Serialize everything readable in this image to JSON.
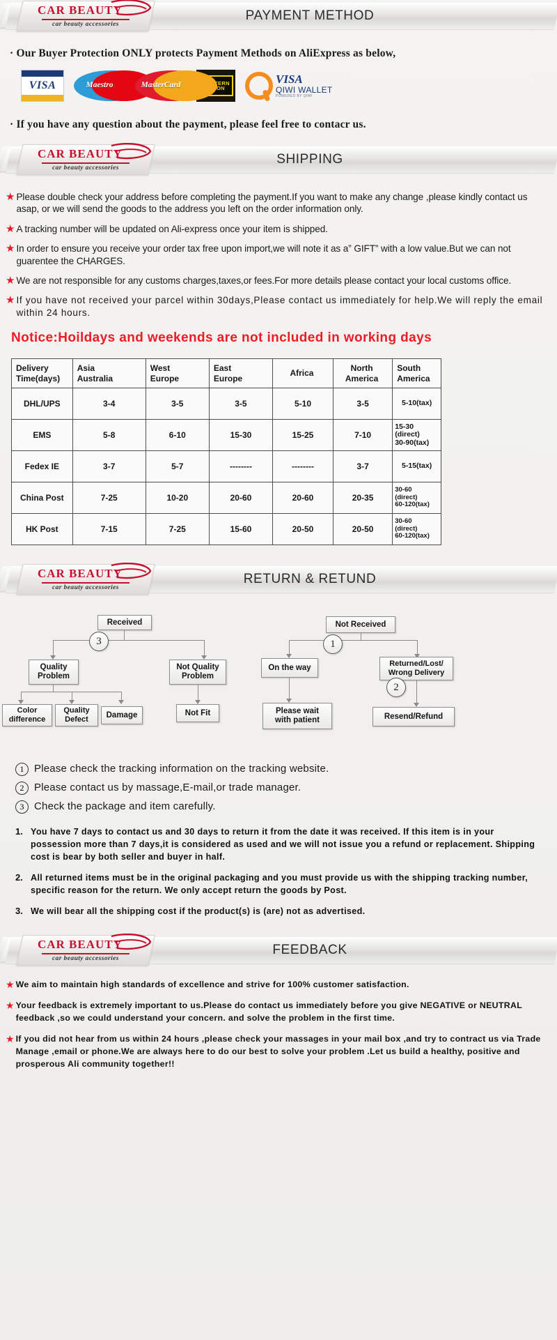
{
  "brand": {
    "name": "CAR  BEAUTY",
    "tagline": "car beauty accessories"
  },
  "sections": {
    "payment": {
      "title": "PAYMENT METHOD",
      "intro": "· Our Buyer Protection ONLY protects Payment Methods on AliExpress as below,",
      "outro": "· If you have any question about the payment, please feel free to contacr us.",
      "logos": [
        {
          "name": "visa-logo",
          "label": "VISA"
        },
        {
          "name": "maestro-logo",
          "label": "Maestro"
        },
        {
          "name": "mastercard-logo",
          "label": "MasterCard"
        },
        {
          "name": "western-union-logo",
          "label_top": "WESTERN",
          "label_bottom": "UNION"
        },
        {
          "name": "qiwi-wallet-logo",
          "visa": "VISA",
          "wallet": "QIWI WALLET",
          "powered": "POWERED BY QIWI"
        }
      ]
    },
    "shipping": {
      "title": "SHIPPING",
      "bullets": [
        "Please double check your address before completing the payment.If you want to make any change ,please kindly contact us asap, or we will send the goods to the address you left on the order information only.",
        "A tracking number will be updated on Ali-express once your item is shipped.",
        "In order to ensure you receive your order tax free upon import,we will note it as a” GIFT” with a low value.But we can not guarentee the CHARGES.",
        "We are not responsible for any customs charges,taxes,or fees.For more details please contact your local customs office.",
        "If you have not received your parcel within 30days,Please contact us immediately for help.We will reply the email within 24 hours."
      ],
      "notice": "Notice:Hoildays and weekends are not included in working days",
      "table": {
        "headers": [
          "Delivery\nTime(days)",
          "Asia\nAustralia",
          "West\nEurope",
          "East\nEurope",
          "Africa",
          "North\nAmerica",
          "South\nAmerica"
        ],
        "rows": [
          {
            "method": "DHL/UPS",
            "values": [
              "3-4",
              "3-5",
              "3-5",
              "5-10",
              "3-5",
              "5-10(tax)"
            ]
          },
          {
            "method": "EMS",
            "values": [
              "5-8",
              "6-10",
              "15-30",
              "15-25",
              "7-10",
              "15-30\n(direct)\n30-90(tax)"
            ]
          },
          {
            "method": "Fedex IE",
            "values": [
              "3-7",
              "5-7",
              "--------",
              "--------",
              "3-7",
              "5-15(tax)"
            ]
          },
          {
            "method": "China Post",
            "values": [
              "7-25",
              "10-20",
              "20-60",
              "20-60",
              "20-35",
              "30-60\n(direct)\n60-120(tax)"
            ]
          },
          {
            "method": "HK Post",
            "values": [
              "7-15",
              "7-25",
              "15-60",
              "20-50",
              "20-50",
              "30-60\n(direct)\n60-120(tax)"
            ]
          }
        ]
      }
    },
    "return": {
      "title": "RETURN & RETUND",
      "flow": {
        "received": "Received",
        "quality_problem": "Quality\nProblem",
        "not_quality_problem": "Not Quality\nProblem",
        "color_difference": "Color\ndifference",
        "quality_defect": "Quality\nDefect",
        "damage": "Damage",
        "not_fit": "Not Fit",
        "not_received": "Not  Received",
        "on_the_way": "On the way",
        "returned_lost": "Returned/Lost/\nWrong Delivery",
        "please_wait": "Please wait\nwith patient",
        "resend_refund": "Resend/Refund",
        "badge_1": "1",
        "badge_2": "2",
        "badge_3": "3"
      },
      "notes": [
        {
          "num": "1",
          "text": "Please check the tracking information on the tracking website."
        },
        {
          "num": "2",
          "text": "Please contact us by  massage,E-mail,or trade manager."
        },
        {
          "num": "3",
          "text": "Check the package and item carefully."
        }
      ],
      "policies": [
        {
          "num": "1.",
          "text": "You have 7 days to contact us and 30 days to return it from the date it was received. If this item is in your possession more than 7 days,it is considered as used and we will not issue you a refund or replacement. Shipping cost is bear by both seller and buyer in half."
        },
        {
          "num": "2.",
          "text": "All returned items must be in the original packaging and you must provide us with the shipping tracking number, specific reason for the return. We only accept return the goods by Post."
        },
        {
          "num": "3.",
          "text": "We will bear all the shipping cost if the product(s) is (are) not as advertised."
        }
      ]
    },
    "feedback": {
      "title": "FEEDBACK",
      "items": [
        "We aim to maintain high standards of excellence and strive  for 100% customer satisfaction.",
        "Your feedback is extremely important to us.Please do contact us immediately before you give NEGATIVE or NEUTRAL feedback ,so  we could understand your concern. and solve the problem in the first time.",
        "If you did not hear from us within 24 hours ,please check your massages in your mail box ,and try to contract us via Trade Manage ,email or phone.We are always here to do our best to solve your problem .Let us build a healthy, positive and prosperous Ali community together!!"
      ]
    }
  },
  "colors": {
    "brand_red": "#c8102e",
    "star_red": "#e8192c",
    "notice_red": "#ee1c25",
    "page_bg": "#f2f1ef"
  }
}
